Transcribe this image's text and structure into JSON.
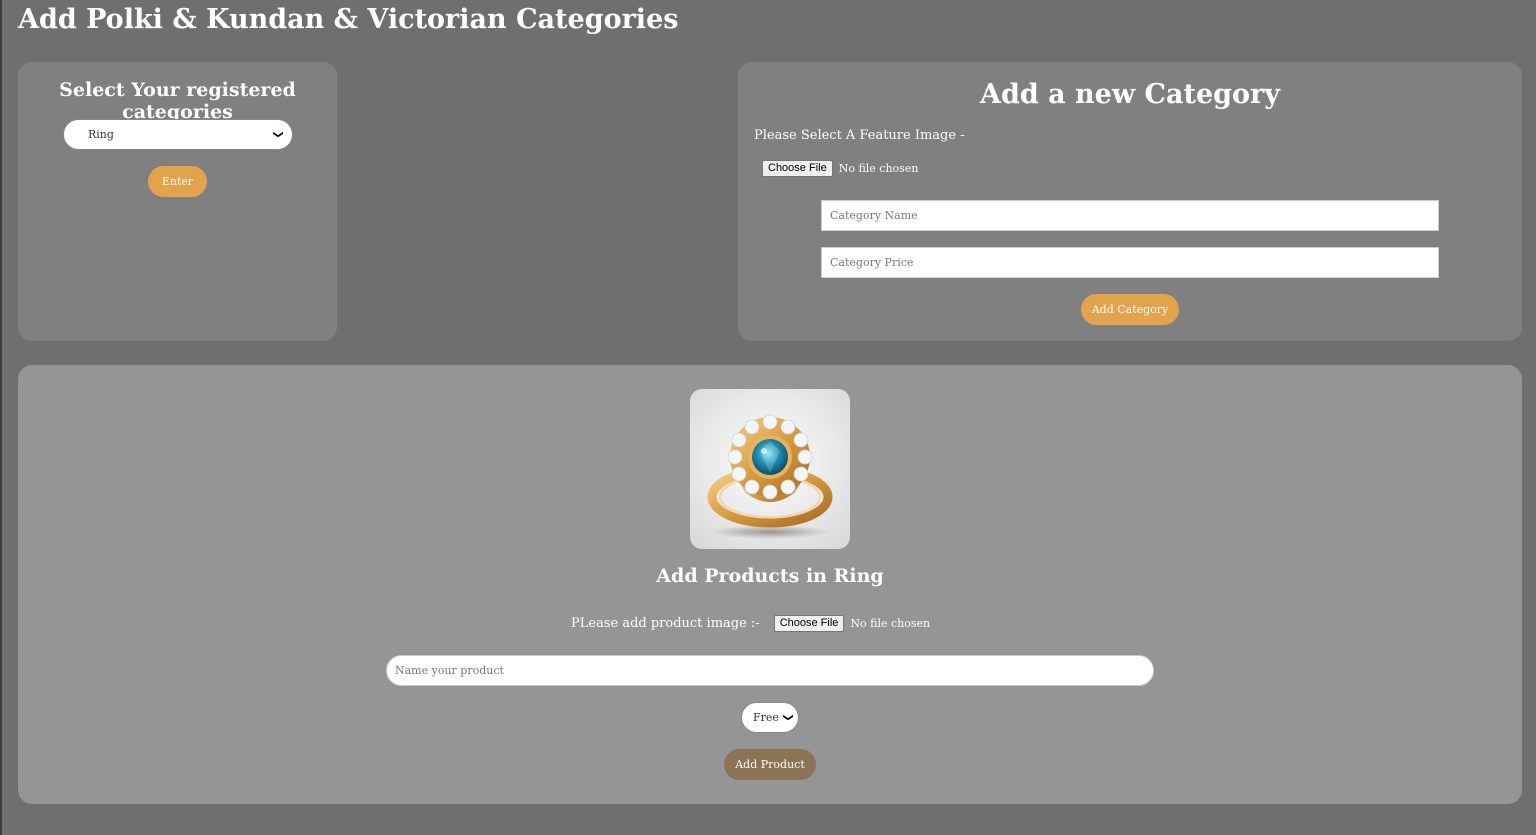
{
  "page": {
    "title": "Add Polki & Kundan & Victorian Categories"
  },
  "select_panel": {
    "heading": "Select Your registered categories",
    "selected_category": "Ring",
    "enter_label": "Enter"
  },
  "new_category": {
    "heading": "Add a new Category",
    "feature_image_label": "Please Select A Feature Image -",
    "choose_file_label": "Choose File",
    "file_status": "No file chosen",
    "name_placeholder": "Category Name",
    "price_placeholder": "Category Price",
    "add_label": "Add Category"
  },
  "products": {
    "heading": "Add Products in Ring",
    "image_label": "PLease add product image :-",
    "choose_file_label": "Choose File",
    "file_status": "No file chosen",
    "name_placeholder": "Name your product",
    "size_selected": "Free",
    "add_label": "Add Product"
  },
  "colors": {
    "background": "#6f6f6f",
    "panel": "#808080",
    "accent": "#e3a34b",
    "add_product": "#8b7355"
  },
  "icons": {
    "select_arrow": "chevron-down-icon",
    "product_image": "ring-image"
  }
}
